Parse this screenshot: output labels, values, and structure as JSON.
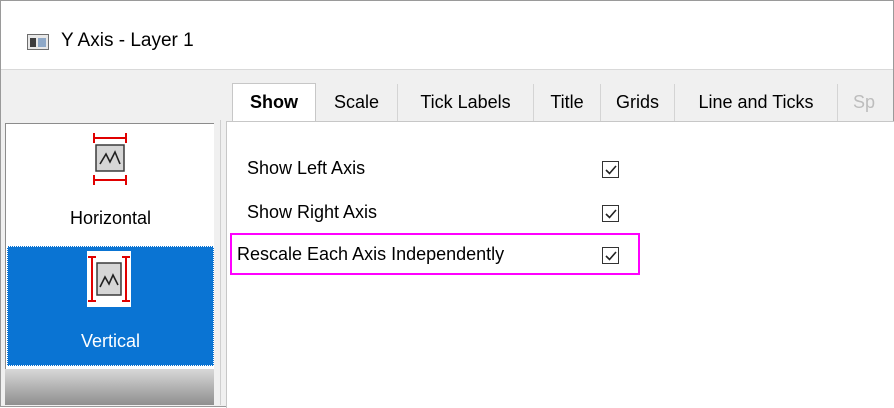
{
  "window": {
    "title": "Y Axis - Layer 1",
    "app_icon": "window-app-icon"
  },
  "sidebar": {
    "items": [
      {
        "label": "Horizontal",
        "icon": "horizontal-axis-icon",
        "selected": false
      },
      {
        "label": "Vertical",
        "icon": "vertical-axis-icon",
        "selected": true
      }
    ],
    "selected_color": "#0a74d3"
  },
  "tabs": [
    {
      "label": "Show",
      "active": true
    },
    {
      "label": "Scale",
      "active": false
    },
    {
      "label": "Tick Labels",
      "active": false
    },
    {
      "label": "Title",
      "active": false
    },
    {
      "label": "Grids",
      "active": false
    },
    {
      "label": "Line and Ticks",
      "active": false
    },
    {
      "label": "Sp",
      "active": false
    }
  ],
  "options": [
    {
      "label": "Show Left Axis",
      "checked": true
    },
    {
      "label": "Show Right Axis",
      "checked": true
    },
    {
      "label": "Rescale Each Axis Independently",
      "checked": true,
      "highlighted": true
    }
  ],
  "colors": {
    "highlight_box": "#ff00ff",
    "axis_marker": "#e00000"
  }
}
